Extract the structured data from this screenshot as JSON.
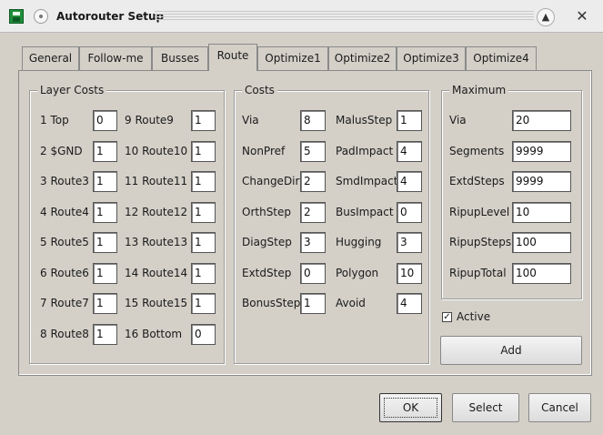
{
  "window": {
    "title": "Autorouter Setup"
  },
  "tabs": [
    {
      "label": "General"
    },
    {
      "label": "Follow-me"
    },
    {
      "label": "Busses"
    },
    {
      "label": "Route"
    },
    {
      "label": "Optimize1"
    },
    {
      "label": "Optimize2"
    },
    {
      "label": "Optimize3"
    },
    {
      "label": "Optimize4"
    }
  ],
  "active_tab": "Route",
  "layer_costs": {
    "title": "Layer Costs",
    "left": [
      {
        "label": "1 Top",
        "value": "0"
      },
      {
        "label": "2 $GND",
        "value": "1"
      },
      {
        "label": "3 Route3",
        "value": "1"
      },
      {
        "label": "4 Route4",
        "value": "1"
      },
      {
        "label": "5 Route5",
        "value": "1"
      },
      {
        "label": "6 Route6",
        "value": "1"
      },
      {
        "label": "7 Route7",
        "value": "1"
      },
      {
        "label": "8 Route8",
        "value": "1"
      }
    ],
    "right": [
      {
        "label": "9 Route9",
        "value": "1"
      },
      {
        "label": "10 Route10",
        "value": "1"
      },
      {
        "label": "11 Route11",
        "value": "1"
      },
      {
        "label": "12 Route12",
        "value": "1"
      },
      {
        "label": "13 Route13",
        "value": "1"
      },
      {
        "label": "14 Route14",
        "value": "1"
      },
      {
        "label": "15 Route15",
        "value": "1"
      },
      {
        "label": "16 Bottom",
        "value": "0"
      }
    ]
  },
  "costs": {
    "title": "Costs",
    "left": [
      {
        "label": "Via",
        "value": "8"
      },
      {
        "label": "NonPref",
        "value": "5"
      },
      {
        "label": "ChangeDir",
        "value": "2"
      },
      {
        "label": "OrthStep",
        "value": "2"
      },
      {
        "label": "DiagStep",
        "value": "3"
      },
      {
        "label": "ExtdStep",
        "value": "0"
      },
      {
        "label": "BonusStep",
        "value": "1"
      }
    ],
    "right": [
      {
        "label": "MalusStep",
        "value": "1"
      },
      {
        "label": "PadImpact",
        "value": "4"
      },
      {
        "label": "SmdImpact",
        "value": "4"
      },
      {
        "label": "BusImpact",
        "value": "0"
      },
      {
        "label": "Hugging",
        "value": "3"
      },
      {
        "label": "Polygon",
        "value": "10"
      },
      {
        "label": "Avoid",
        "value": "4"
      }
    ]
  },
  "maximum": {
    "title": "Maximum",
    "rows": [
      {
        "label": "Via",
        "value": "20"
      },
      {
        "label": "Segments",
        "value": "9999"
      },
      {
        "label": "ExtdSteps",
        "value": "9999"
      },
      {
        "label": "RipupLevel",
        "value": "10"
      },
      {
        "label": "RipupSteps",
        "value": "100"
      },
      {
        "label": "RipupTotal",
        "value": "100"
      }
    ]
  },
  "active_checkbox": {
    "label": "Active",
    "checked": true
  },
  "buttons": {
    "add": "Add",
    "ok": "OK",
    "select": "Select",
    "cancel": "Cancel"
  }
}
